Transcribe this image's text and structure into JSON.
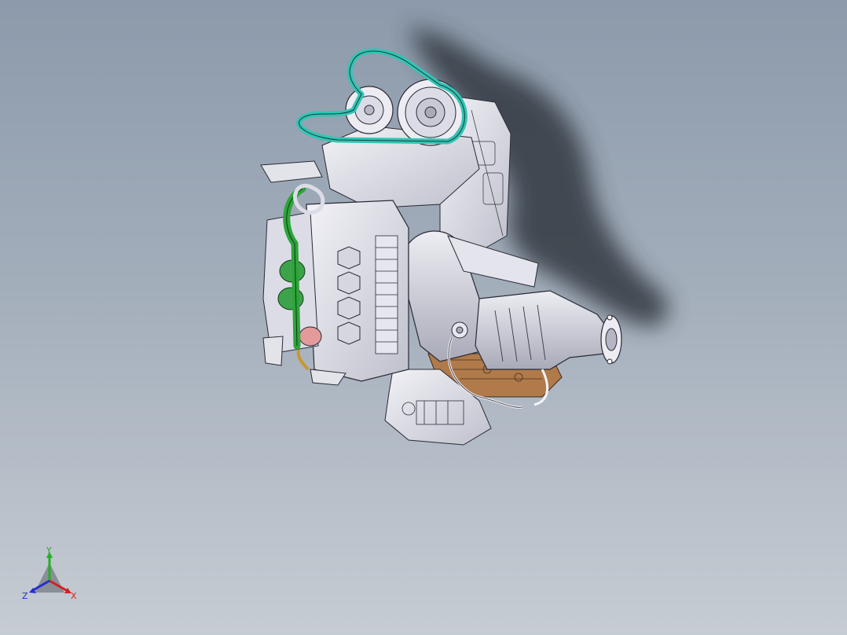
{
  "triad": {
    "x_label": "X",
    "y_label": "Y",
    "z_label": "Z",
    "x_color": "#d42020",
    "y_color": "#22b022",
    "z_color": "#2030d0"
  },
  "model": {
    "belt_color": "#33c4b4",
    "hose_color": "#2ea43a",
    "oilpan_color": "#b07a4a",
    "body_color": "#e8e8ee",
    "shadow_color": "#3a3f47"
  }
}
